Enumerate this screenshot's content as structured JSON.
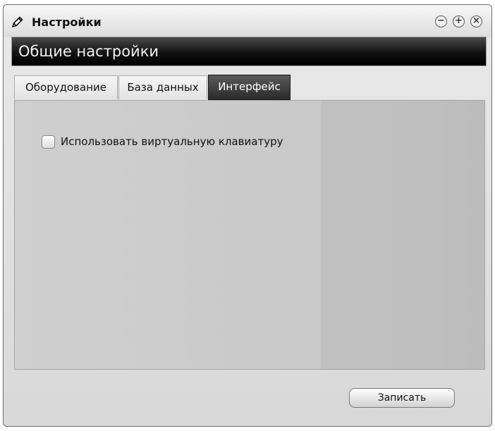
{
  "window": {
    "title": "Настройки",
    "icon": "pencil-icon",
    "controls": {
      "minimize": "−",
      "maximize": "+",
      "close": "×"
    }
  },
  "header": {
    "title": "Общие настройки"
  },
  "tabs": [
    {
      "label": "Оборудование",
      "active": false
    },
    {
      "label": "База данных",
      "active": false
    },
    {
      "label": "Интерфейс",
      "active": true
    }
  ],
  "interface_tab": {
    "virtual_keyboard": {
      "label": "Использовать виртуальную клавиатуру",
      "checked": false
    }
  },
  "footer": {
    "save_label": "Записать"
  }
}
